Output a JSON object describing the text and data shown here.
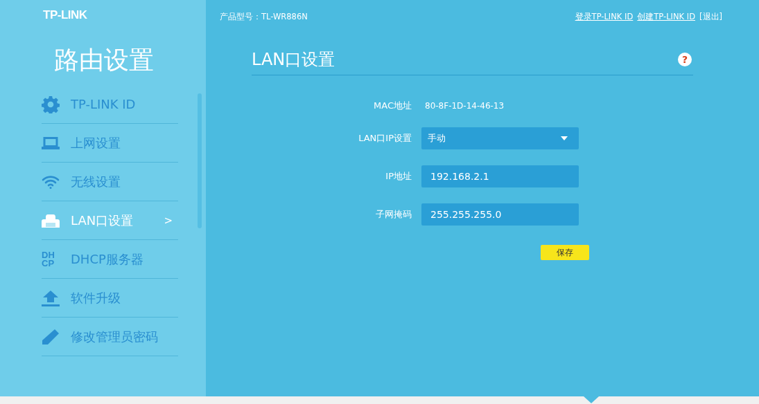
{
  "sidebar": {
    "logo": "TP-LINK",
    "title": "路由设置",
    "items": [
      {
        "kind": "gear",
        "label": "TP-LINK ID",
        "selected": false
      },
      {
        "kind": "laptop",
        "label": "上网设置",
        "selected": false
      },
      {
        "kind": "wifi",
        "label": "无线设置",
        "selected": false
      },
      {
        "kind": "ethernet",
        "label": "LAN口设置",
        "selected": true,
        "arrow": ">"
      },
      {
        "kind": "dhcp",
        "icon_text": [
          "DH",
          "CP"
        ],
        "label": "DHCP服务器",
        "selected": false
      },
      {
        "kind": "upload",
        "label": "软件升级",
        "selected": false
      },
      {
        "kind": "pencil",
        "label": "修改管理员密码",
        "selected": false
      }
    ]
  },
  "header": {
    "model": "产品型号：TL-WR886N",
    "links": [
      "登录TP-LINK ID",
      "创建TP-LINK ID",
      "[退出]"
    ]
  },
  "page": {
    "title": "LAN口设置",
    "help": "?",
    "fields": [
      {
        "kind": "text",
        "label": "MAC地址",
        "value": "80-8F-1D-14-46-13"
      },
      {
        "kind": "select",
        "label": "LAN口IP设置",
        "value": "手动"
      },
      {
        "kind": "input",
        "label": "IP地址",
        "value": "192.168.2.1"
      },
      {
        "kind": "input",
        "label": "子网掩码",
        "value": "255.255.255.0"
      }
    ],
    "save": "保存"
  }
}
